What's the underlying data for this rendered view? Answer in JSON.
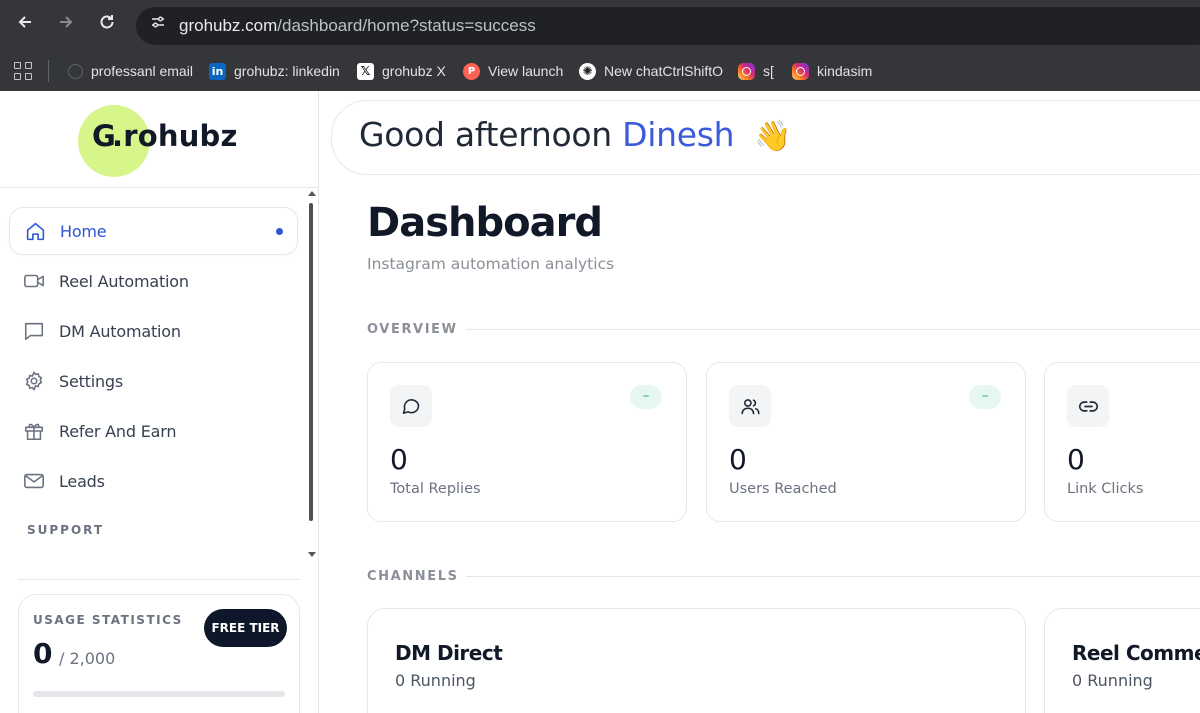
{
  "browser": {
    "url_host": "grohubz.com",
    "url_path": "/dashboard/home?status=success",
    "bookmarks": [
      {
        "label": "professanl email",
        "icon": "globe-icon"
      },
      {
        "label": "grohubz: linkedin",
        "icon": "linkedin-icon"
      },
      {
        "label": "grohubz X",
        "icon": "x-icon"
      },
      {
        "label": "View launch",
        "icon": "producthunt-icon"
      },
      {
        "label": "New chatCtrlShiftO",
        "icon": "chatgpt-icon"
      },
      {
        "label": "s[",
        "icon": "instagram-icon"
      },
      {
        "label": "kindasim",
        "icon": "instagram-icon"
      }
    ]
  },
  "sidebar": {
    "logo_text": "G.rohubz",
    "items": [
      {
        "label": "Home",
        "icon": "home-icon",
        "active": true
      },
      {
        "label": "Reel Automation",
        "icon": "video-icon"
      },
      {
        "label": "DM Automation",
        "icon": "message-square-icon"
      },
      {
        "label": "Settings",
        "icon": "gear-icon"
      },
      {
        "label": "Refer And Earn",
        "icon": "gift-icon"
      },
      {
        "label": "Leads",
        "icon": "mail-icon"
      }
    ],
    "support_label": "SUPPORT",
    "usage": {
      "title": "USAGE STATISTICS",
      "count": "0",
      "limit": "/ 2,000",
      "tier": "FREE TIER",
      "progress": 0
    }
  },
  "main": {
    "greeting": "Good afternoon",
    "user_name": "Dinesh",
    "greeting_emoji": "👋",
    "title": "Dashboard",
    "subtitle": "Instagram automation analytics",
    "overview_label": "OVERVIEW",
    "stats": [
      {
        "value": "0",
        "label": "Total Replies",
        "icon": "chat-bubble-icon",
        "badge": "–"
      },
      {
        "value": "0",
        "label": "Users Reached",
        "icon": "users-icon",
        "badge": "–"
      },
      {
        "value": "0",
        "label": "Link Clicks",
        "icon": "link-icon"
      }
    ],
    "channels_label": "CHANNELS",
    "channels": [
      {
        "title": "DM Direct",
        "status": "0 Running"
      },
      {
        "title": "Reel Commer",
        "status": "0 Running"
      }
    ]
  },
  "colors": {
    "accent": "#2f55d4",
    "logo_bg": "#d6f58a",
    "tier_badge": "#0f172a",
    "positive_badge": "#e6f7f2"
  }
}
